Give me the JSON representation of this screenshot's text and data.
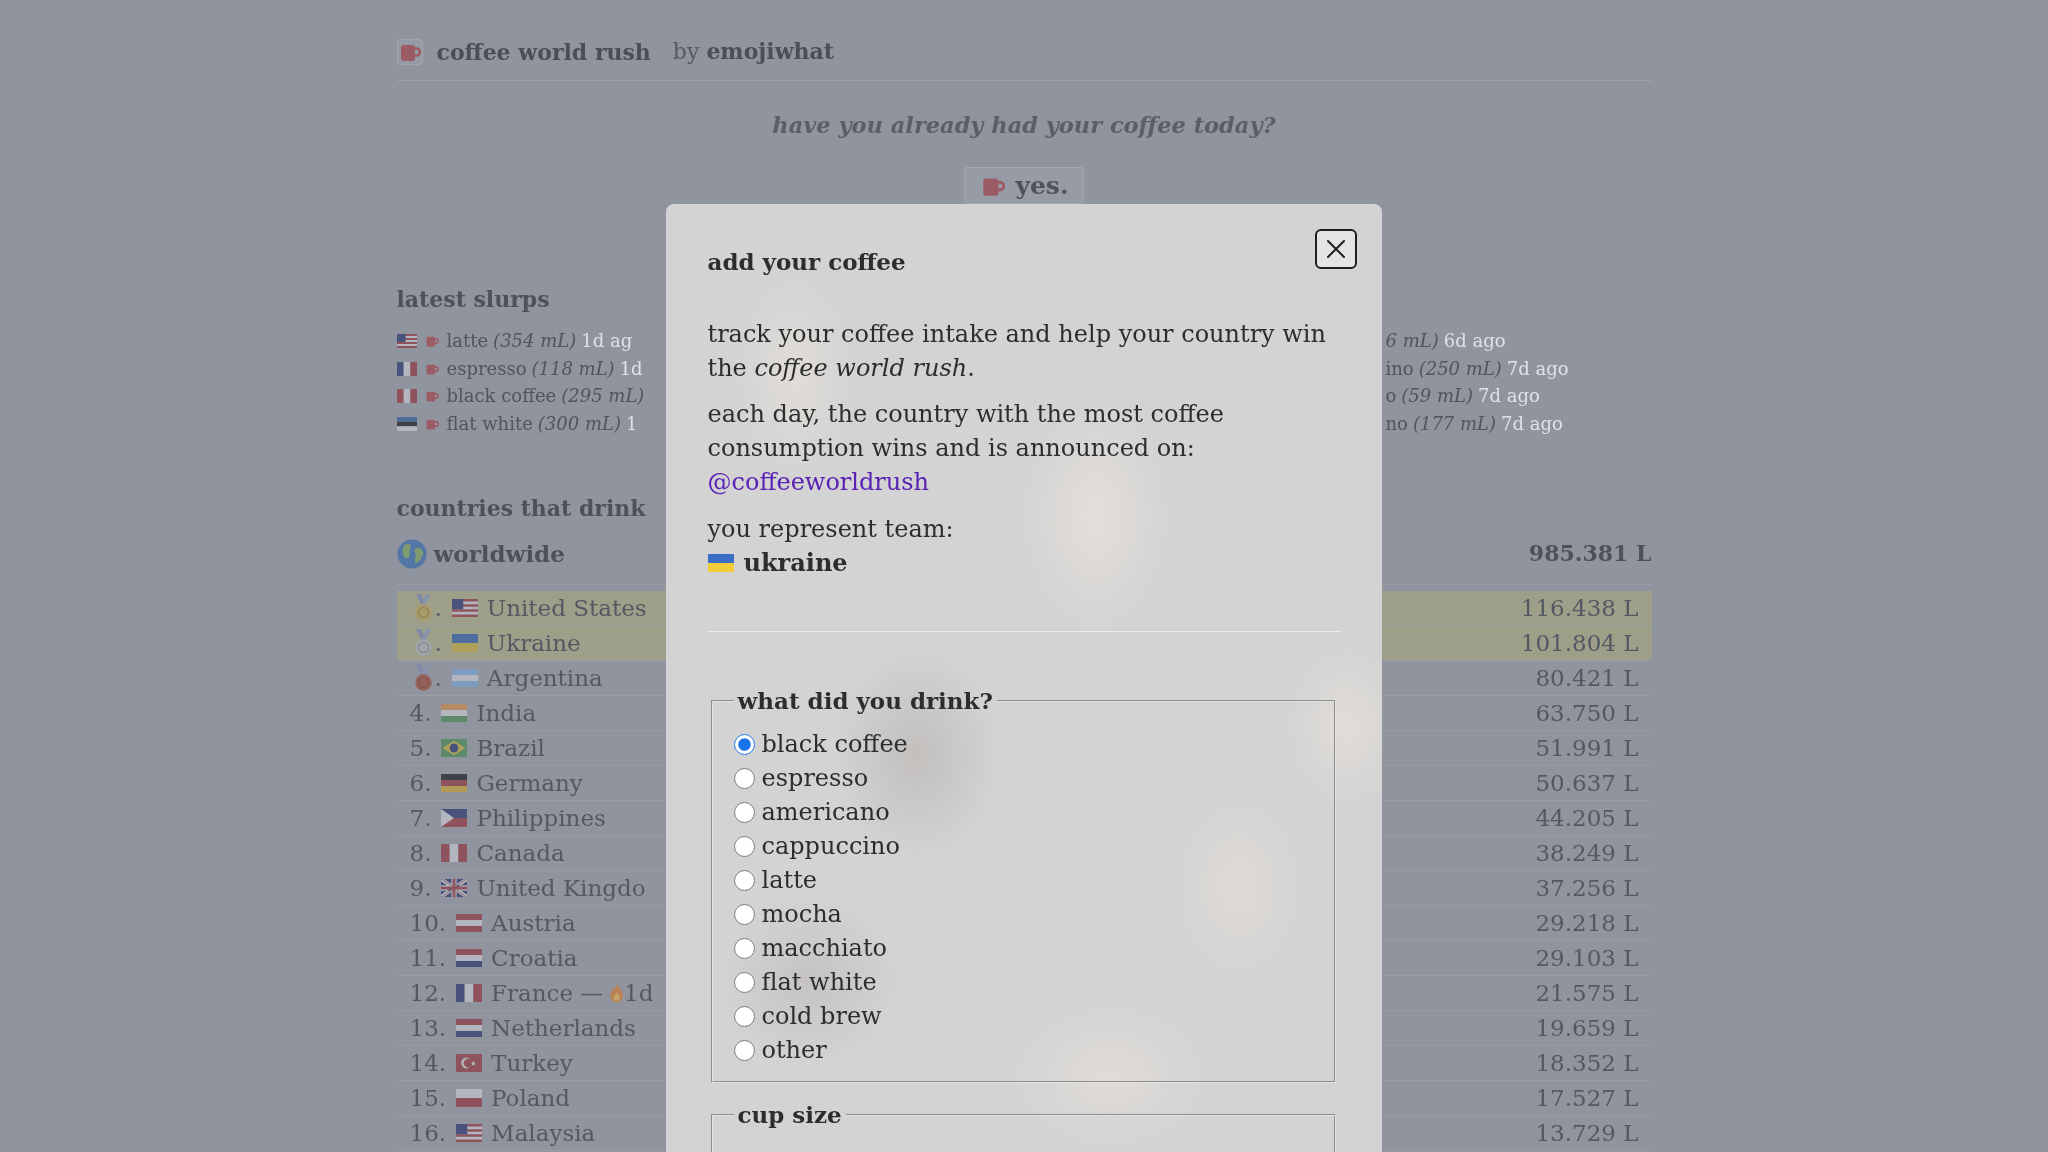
{
  "header": {
    "title": "coffee world rush",
    "byline": "by **emojiwhat**"
  },
  "prompt": {
    "question": "have you already had your coffee today?",
    "button": "yes."
  },
  "latest_slurps": {
    "title": "latest slurps",
    "rows": [
      {
        "left": {
          "flag": {
            "kind": "canton",
            "parts": [
              {
                "color": "#8e535c"
              },
              {
                "color": "#b3b6be"
              },
              {
                "color": "#48527a"
              }
            ]
          },
          "mug": true,
          "drink": "latte",
          "amount": "(354 mL)",
          "time": "1d ag"
        },
        "right": {
          "amount": "6 mL)",
          "time": "6d ago"
        }
      },
      {
        "left": {
          "flag": {
            "kind": "stripes-v",
            "parts": [
              {
                "color": "#48527a"
              },
              {
                "color": "#b3b6be"
              },
              {
                "color": "#8e535c"
              }
            ]
          },
          "mug": true,
          "drink": "espresso",
          "amount": "(118 mL)",
          "time": "1d"
        },
        "right": {
          "drink": "ino",
          "amount": "(250 mL)",
          "time": "7d ago"
        }
      },
      {
        "left": {
          "flag": {
            "kind": "stripes-v",
            "parts": [
              {
                "color": "#8e535c"
              },
              {
                "color": "#b3b6be"
              },
              {
                "color": "#8e535c"
              }
            ]
          },
          "mug": true,
          "drink": "black coffee",
          "amount": "(295 mL)"
        },
        "right": {
          "drink": "o",
          "amount": "(59 mL)",
          "time": "7d ago"
        }
      },
      {
        "left": {
          "flag": {
            "kind": "stripes-h",
            "parts": [
              {
                "color": "#4e6d9c"
              },
              {
                "color": "#3f4149"
              },
              {
                "color": "#b3b6be"
              }
            ]
          },
          "mug": true,
          "drink": "flat white",
          "amount": "(300 mL)",
          "time": "1"
        },
        "right": {
          "drink": "no",
          "amount": "(177 mL)",
          "time": "7d ago"
        }
      }
    ]
  },
  "countries": {
    "title": "countries that drink",
    "worldwide": {
      "label": "worldwide",
      "total": "985.381 L"
    },
    "rows": [
      {
        "rank": ".",
        "medal": {
          "color": "#a89d68"
        },
        "flag": {
          "kind": "canton",
          "parts": [
            {
              "color": "#8e535c"
            },
            {
              "color": "#b3b6be"
            },
            {
              "color": "#48527a"
            }
          ]
        },
        "name": "United States",
        "amount": "116.438 L",
        "highlighted": true
      },
      {
        "rank": ".",
        "medal": {
          "color": "#a0a4ac"
        },
        "flag": {
          "kind": "stripes-h",
          "parts": [
            {
              "color": "#4e6d9c"
            },
            {
              "color": "#aea05a"
            }
          ]
        },
        "name": "Ukraine",
        "amount": "101.804 L",
        "highlighted": true
      },
      {
        "rank": ".",
        "medal": {
          "color": "#97615c"
        },
        "flag": {
          "kind": "stripes-h",
          "parts": [
            {
              "color": "#7d9cbf"
            },
            {
              "color": "#b3b6be"
            },
            {
              "color": "#7d9cbf"
            }
          ]
        },
        "name": "Argentina",
        "amount": "80.421 L",
        "highlighted": false
      },
      {
        "rank": "4.",
        "flag": {
          "kind": "stripes-h",
          "parts": [
            {
              "color": "#b58a68"
            },
            {
              "color": "#b3b6be"
            },
            {
              "color": "#5e8a6c"
            }
          ]
        },
        "name": "India",
        "amount": "63.750 L",
        "highlighted": false
      },
      {
        "rank": "5.",
        "flag": {
          "kind": "diamond",
          "parts": [
            {
              "color": "#5e8a6c"
            },
            {
              "color": "#aea05a"
            },
            {
              "color": "#48527a"
            }
          ]
        },
        "name": "Brazil",
        "amount": "51.991 L",
        "highlighted": false
      },
      {
        "rank": "6.",
        "flag": {
          "kind": "stripes-h",
          "parts": [
            {
              "color": "#3f4149"
            },
            {
              "color": "#8e535c"
            },
            {
              "color": "#b39a55"
            }
          ]
        },
        "name": "Germany",
        "amount": "50.637 L",
        "highlighted": false
      },
      {
        "rank": "7.",
        "flag": {
          "kind": "triangle",
          "parts": [
            {
              "color": "#48527a"
            },
            {
              "color": "#8e535c"
            },
            {
              "color": "#b3b6be"
            }
          ]
        },
        "name": "Philippines",
        "amount": "44.205 L",
        "highlighted": false
      },
      {
        "rank": "8.",
        "flag": {
          "kind": "stripes-v",
          "parts": [
            {
              "color": "#8e535c"
            },
            {
              "color": "#b3b6be"
            },
            {
              "color": "#8e535c"
            }
          ]
        },
        "name": "Canada",
        "amount": "38.249 L",
        "highlighted": false
      },
      {
        "rank": "9.",
        "flag": {
          "kind": "union",
          "parts": [
            {
              "color": "#48527a"
            },
            {
              "color": "#b3b6be"
            },
            {
              "color": "#8e535c"
            }
          ]
        },
        "name": "United Kingdo",
        "amount": "37.256 L",
        "highlighted": false
      },
      {
        "rank": "10.",
        "flag": {
          "kind": "stripes-h",
          "parts": [
            {
              "color": "#8e535c"
            },
            {
              "color": "#b3b6be"
            },
            {
              "color": "#8e535c"
            }
          ]
        },
        "name": "Austria",
        "amount": "29.218 L",
        "highlighted": false
      },
      {
        "rank": "11.",
        "flag": {
          "kind": "stripes-h",
          "parts": [
            {
              "color": "#8e535c"
            },
            {
              "color": "#b3b6be"
            },
            {
              "color": "#48527a"
            }
          ]
        },
        "name": "Croatia",
        "amount": "29.103 L",
        "highlighted": false
      },
      {
        "rank": "12.",
        "flag": {
          "kind": "stripes-v",
          "parts": [
            {
              "color": "#48527a"
            },
            {
              "color": "#b3b6be"
            },
            {
              "color": "#8e535c"
            }
          ]
        },
        "name": "France",
        "streak": {
          "separator": "—",
          "days": "1d"
        },
        "amount": "21.575 L",
        "highlighted": false
      },
      {
        "rank": "13.",
        "flag": {
          "kind": "stripes-h",
          "parts": [
            {
              "color": "#8e535c"
            },
            {
              "color": "#b3b6be"
            },
            {
              "color": "#48527a"
            }
          ]
        },
        "name": "Netherlands",
        "amount": "19.659 L",
        "highlighted": false
      },
      {
        "rank": "14.",
        "flag": {
          "kind": "crescent",
          "parts": [
            {
              "color": "#8e535c"
            },
            {
              "color": "#b3b6be"
            }
          ]
        },
        "name": "Turkey",
        "amount": "18.352 L",
        "highlighted": false
      },
      {
        "rank": "15.",
        "flag": {
          "kind": "stripes-h",
          "parts": [
            {
              "color": "#b3b6be"
            },
            {
              "color": "#8e535c"
            }
          ]
        },
        "name": "Poland",
        "amount": "17.527 L",
        "highlighted": false
      },
      {
        "rank": "16.",
        "flag": {
          "kind": "canton",
          "parts": [
            {
              "color": "#8e535c"
            },
            {
              "color": "#b3b6be"
            },
            {
              "color": "#48527a"
            }
          ]
        },
        "name": "Malaysia",
        "amount": "13.729 L",
        "highlighted": false
      }
    ]
  },
  "modal": {
    "title": "add your coffee",
    "intro": "track your coffee intake and help your country win the *coffee world rush*.",
    "announcement": "each day, the country with the most coffee consumption wins and is announced on:",
    "link": "@coffeeworldrush",
    "team_label": "you represent team:",
    "team": {
      "flag": {
        "kind": "stripes-h",
        "parts": [
          {
            "color": "#3b6fc6"
          },
          {
            "color": "#f2cd3a"
          }
        ]
      },
      "name": "ukraine"
    },
    "fieldsets": [
      {
        "legend": "what did you drink?",
        "options": [
          {
            "label": "black coffee",
            "selected": true
          },
          {
            "label": "espresso",
            "selected": false
          },
          {
            "label": "americano",
            "selected": false
          },
          {
            "label": "cappuccino",
            "selected": false
          },
          {
            "label": "latte",
            "selected": false
          },
          {
            "label": "mocha",
            "selected": false
          },
          {
            "label": "macchiato",
            "selected": false
          },
          {
            "label": "flat white",
            "selected": false
          },
          {
            "label": "cold brew",
            "selected": false
          },
          {
            "label": "other",
            "selected": false
          }
        ]
      },
      {
        "legend": "cup size"
      }
    ]
  }
}
